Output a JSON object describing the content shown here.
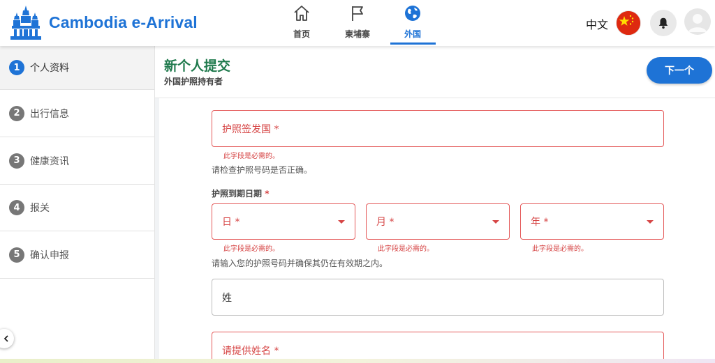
{
  "header": {
    "brand": "Cambodia e-Arrival",
    "nav": [
      {
        "label": "首页",
        "icon": "home-icon"
      },
      {
        "label": "柬埔寨",
        "icon": "flag-icon"
      },
      {
        "label": "外国",
        "icon": "globe-icon",
        "active": true
      }
    ],
    "language": "中文",
    "flag_icon": "china-flag-icon",
    "notifications_icon": "bell-icon",
    "avatar_icon": "user-avatar-icon"
  },
  "sidebar": {
    "steps": [
      {
        "number": "1",
        "label": "个人资料",
        "active": true
      },
      {
        "number": "2",
        "label": "出行信息"
      },
      {
        "number": "3",
        "label": "健康资讯"
      },
      {
        "number": "4",
        "label": "报关"
      },
      {
        "number": "5",
        "label": "确认申报"
      }
    ],
    "collapse_icon": "chevron-left-icon"
  },
  "main": {
    "title": "新个人提交",
    "subtitle": "外国护照持有者",
    "next_button": "下一个"
  },
  "form": {
    "issuing_country": {
      "placeholder": "护照签发国 *",
      "error": "此字段是必需的。",
      "hint": "请检查护照号码是否正确。"
    },
    "expiry": {
      "label": "护照到期日期",
      "required_mark": "*",
      "day": {
        "placeholder": "日 *",
        "error": "此字段是必需的。"
      },
      "month": {
        "placeholder": "月 *",
        "error": "此字段是必需的。"
      },
      "year": {
        "placeholder": "年 *",
        "error": "此字段是必需的。"
      },
      "hint": "请输入您的护照号码并确保其仍在有效期之内。"
    },
    "surname": {
      "placeholder": "姓"
    },
    "given_name": {
      "placeholder": "请提供姓名 *"
    }
  },
  "colors": {
    "primary": "#1e73d6",
    "title_green": "#1f7a4d",
    "error_red": "#d64545"
  }
}
